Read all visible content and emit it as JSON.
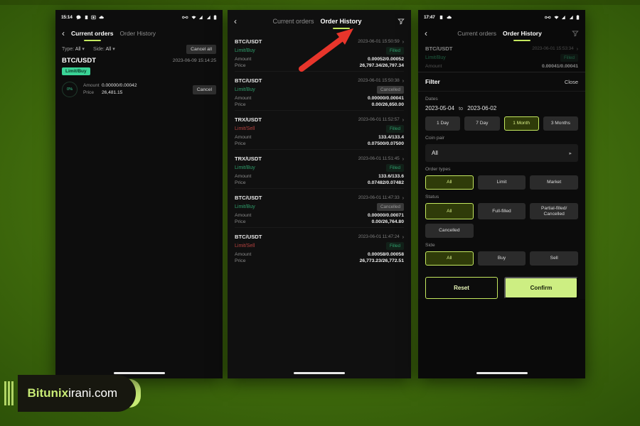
{
  "watermark": {
    "brand": "Bitunix",
    "domain": "irani.com"
  },
  "phone1": {
    "status": {
      "time": "15:14"
    },
    "nav": {
      "back": "‹",
      "tab_current": "Current orders",
      "tab_history": "Order History"
    },
    "filters": {
      "type_label": "Type:",
      "type_value": "All",
      "side_label": "Side:",
      "side_value": "All",
      "cancel_all": "Cancel all"
    },
    "order": {
      "pair": "BTC/USDT",
      "date": "2023-06-09 15:14:25",
      "tag": "Limit/Buy",
      "percent": "0%",
      "amount_label": "Amount",
      "amount_value": "0.00000/0.00042",
      "price_label": "Price",
      "price_value": "26,481.15",
      "cancel": "Cancel"
    }
  },
  "phone2": {
    "nav": {
      "back": "‹",
      "tab_current": "Current orders",
      "tab_history": "Order History"
    },
    "orders": [
      {
        "pair": "BTC/USDT",
        "date": "2023-06-01 15:50:59",
        "side": "Limit/Buy",
        "side_kind": "buy",
        "status": "Filled",
        "status_kind": "filled",
        "amount_label": "Amount",
        "amount_value": "0.00052/0.00052",
        "price_label": "Price",
        "price_value": "26,797.34/26,797.34"
      },
      {
        "pair": "BTC/USDT",
        "date": "2023-06-01 15:50:38",
        "side": "Limit/Buy",
        "side_kind": "buy",
        "status": "Cancelled",
        "status_kind": "cancelled",
        "amount_label": "Amount",
        "amount_value": "0.00000/0.00041",
        "price_label": "Price",
        "price_value": "0.00/26,650.00"
      },
      {
        "pair": "TRX/USDT",
        "date": "2023-06-01 11:52:57",
        "side": "Limit/Sell",
        "side_kind": "sell",
        "status": "Filled",
        "status_kind": "filled",
        "amount_label": "Amount",
        "amount_value": "133.4/133.4",
        "price_label": "Price",
        "price_value": "0.07500/0.07500"
      },
      {
        "pair": "TRX/USDT",
        "date": "2023-06-01 11:51:45",
        "side": "Limit/Buy",
        "side_kind": "buy",
        "status": "Filled",
        "status_kind": "filled",
        "amount_label": "Amount",
        "amount_value": "133.6/133.6",
        "price_label": "Price",
        "price_value": "0.07482/0.07482"
      },
      {
        "pair": "BTC/USDT",
        "date": "2023-06-01 11:47:33",
        "side": "Limit/Buy",
        "side_kind": "buy",
        "status": "Cancelled",
        "status_kind": "cancelled",
        "amount_label": "Amount",
        "amount_value": "0.00000/0.00071",
        "price_label": "Price",
        "price_value": "0.00/26,764.80"
      },
      {
        "pair": "BTC/USDT",
        "date": "2023-06-01 11:47:24",
        "side": "Limit/Sell",
        "side_kind": "sell",
        "status": "Filled",
        "status_kind": "filled",
        "amount_label": "Amount",
        "amount_value": "0.00058/0.00058",
        "price_label": "Price",
        "price_value": "26,773.23/26,772.51"
      }
    ],
    "annotation": {
      "color": "#e8352b",
      "points_to": "Order History"
    }
  },
  "phone3": {
    "status": {
      "time": "17:47"
    },
    "nav": {
      "back": "‹",
      "tab_current": "Current orders",
      "tab_history": "Order History"
    },
    "peek_order": {
      "pair": "BTC/USDT",
      "date": "2023-06-01 15:53:34",
      "side": "Limit/Buy",
      "status": "Filled",
      "amount_label": "Amount",
      "amount_value": "0.00041/0.00041"
    },
    "filter": {
      "title": "Filter",
      "close": "Close",
      "dates_label": "Dates",
      "date_from": "2023-05-04",
      "date_to_word": "to",
      "date_to": "2023-06-02",
      "date_chips": [
        {
          "label": "1 Day",
          "selected": false
        },
        {
          "label": "7 Day",
          "selected": false
        },
        {
          "label": "1 Month",
          "selected": true
        },
        {
          "label": "3 Months",
          "selected": false
        }
      ],
      "coin_pair_label": "Coin pair",
      "coin_pair_value": "All",
      "order_types_label": "Order types",
      "order_types": [
        {
          "label": "All",
          "selected": true
        },
        {
          "label": "Limit",
          "selected": false
        },
        {
          "label": "Market",
          "selected": false
        }
      ],
      "status_label": "Status",
      "status_chips": [
        {
          "label": "All",
          "selected": true
        },
        {
          "label": "Full-filled",
          "selected": false
        },
        {
          "label": "Partial-filled/ Cancelled",
          "selected": false
        },
        {
          "label": "Cancelled",
          "selected": false
        }
      ],
      "side_label": "Side",
      "side_chips": [
        {
          "label": "All",
          "selected": true
        },
        {
          "label": "Buy",
          "selected": false
        },
        {
          "label": "Sell",
          "selected": false
        }
      ],
      "reset": "Reset",
      "confirm": "Confirm"
    }
  },
  "colors": {
    "accent": "#c4e85f",
    "confirm_bg": "#cdee82",
    "buy": "#2f9e6b",
    "sell": "#b5423f",
    "arrow": "#e8352b"
  }
}
